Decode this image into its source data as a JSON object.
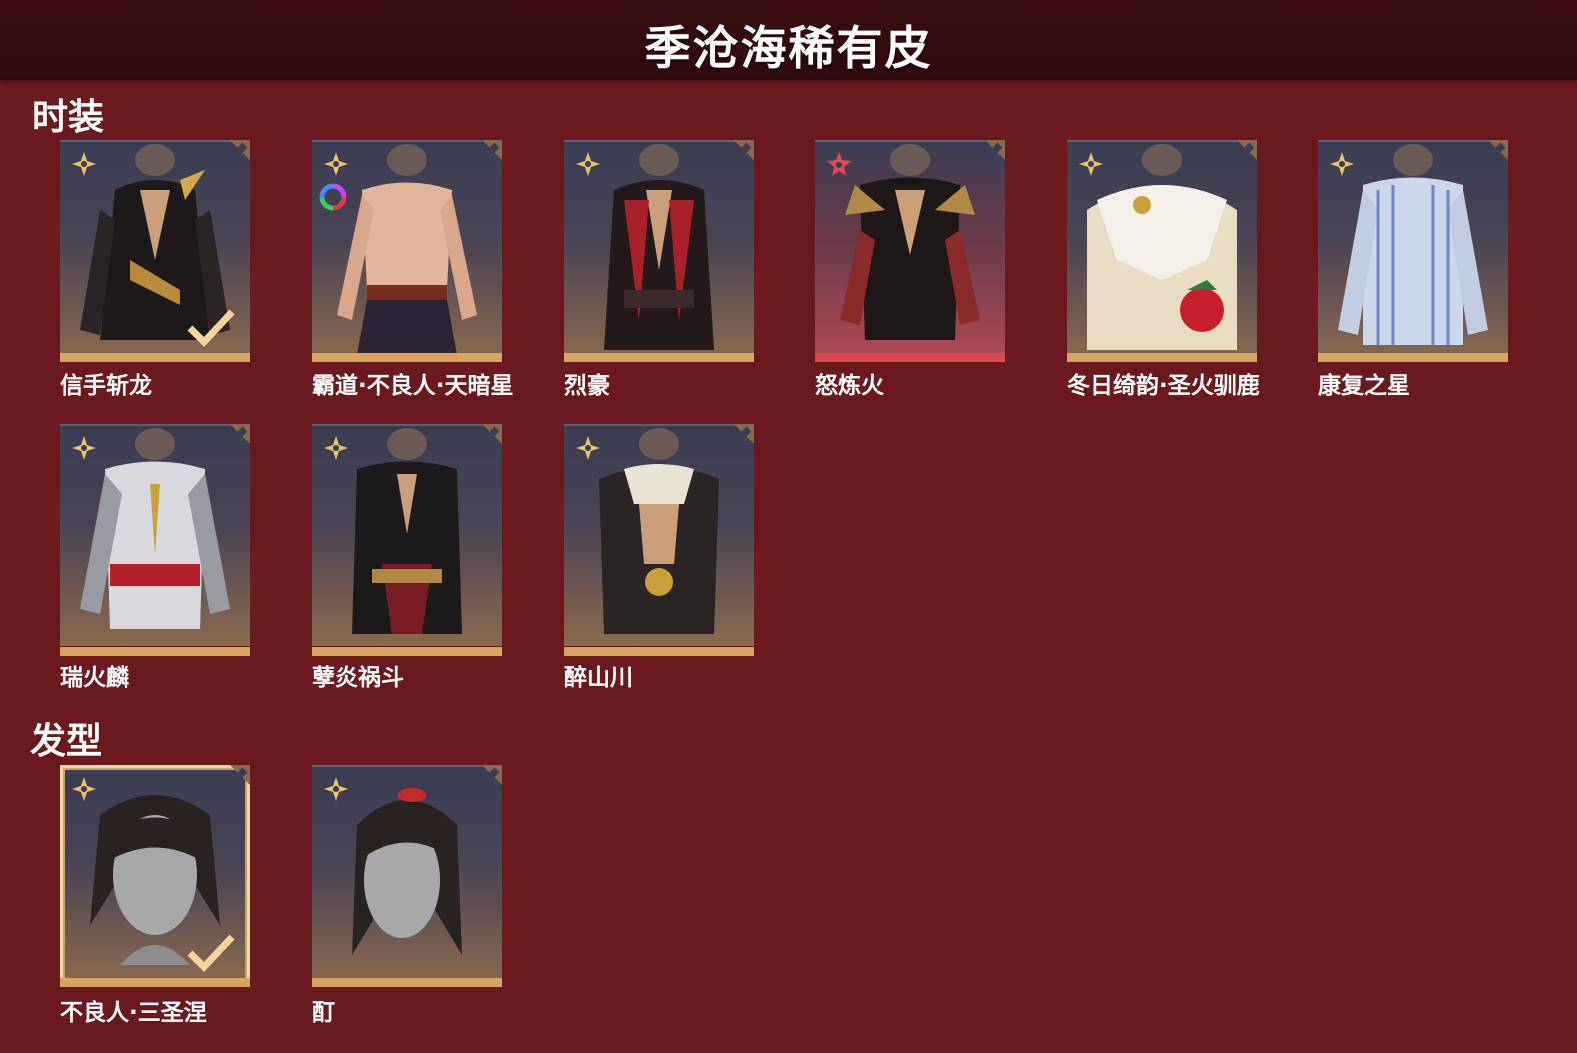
{
  "header": {
    "title": "季沧海稀有皮"
  },
  "sections": {
    "outfits": {
      "title": "时装",
      "items": [
        {
          "name": "信手斩龙",
          "rarity": "gold",
          "selected": true,
          "has_dye": false
        },
        {
          "name": "霸道·不良人·天暗星",
          "rarity": "gold",
          "selected": false,
          "has_dye": true
        },
        {
          "name": "烈豪",
          "rarity": "gold",
          "selected": false,
          "has_dye": false
        },
        {
          "name": "怒炼火",
          "rarity": "red",
          "selected": false,
          "has_dye": false
        },
        {
          "name": "冬日绮韵·圣火驯鹿",
          "rarity": "gold",
          "selected": false,
          "has_dye": false
        },
        {
          "name": "康复之星",
          "rarity": "gold",
          "selected": false,
          "has_dye": false
        },
        {
          "name": "瑞火麟",
          "rarity": "gold",
          "selected": false,
          "has_dye": false
        },
        {
          "name": "孽炎祸斗",
          "rarity": "gold",
          "selected": false,
          "has_dye": false
        },
        {
          "name": "醉山川",
          "rarity": "gold",
          "selected": false,
          "has_dye": false
        }
      ]
    },
    "hair": {
      "title": "发型",
      "items": [
        {
          "name": "不良人·三圣涅",
          "rarity": "gold",
          "selected": true
        },
        {
          "name": "酊",
          "rarity": "gold",
          "selected": false
        }
      ]
    }
  },
  "colors": {
    "background": "#6a1a1e",
    "header_bg": "#2c0a0c",
    "gold_accent": "#d7a560",
    "red_accent": "#d94a56"
  },
  "icons": {
    "rarity_gold": "gold-flower-icon",
    "rarity_red": "red-flower-icon",
    "selected": "checkmark-icon",
    "dye": "color-wheel-icon"
  }
}
